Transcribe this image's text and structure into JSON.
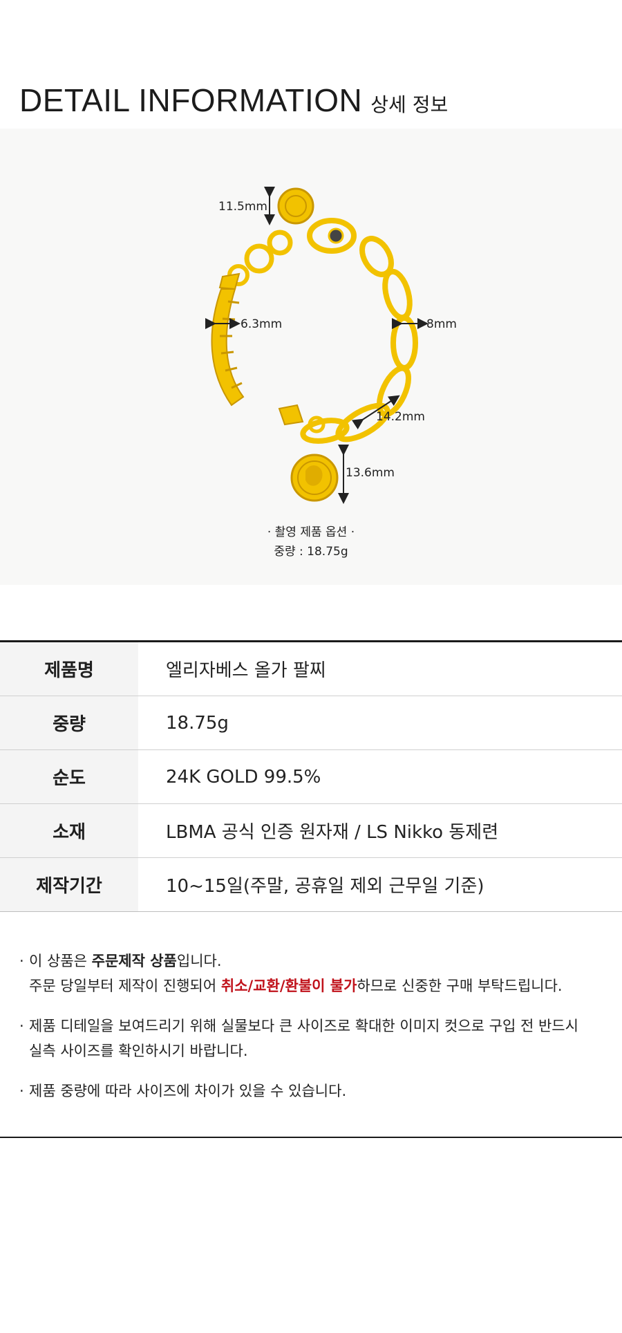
{
  "header": {
    "title_en": "DETAIL INFORMATION",
    "title_ko": "상세 정보"
  },
  "photo": {
    "dimensions": {
      "d1": "11.5mm",
      "d2": "6.3mm",
      "d3": "8mm",
      "d4": "14.2mm",
      "d5": "13.6mm"
    },
    "caption_line1": "· 촬영 제품 옵션 ·",
    "caption_line2": "중량 : 18.75g",
    "colors": {
      "gold": "#f2c200",
      "gold_dark": "#c99700",
      "background": "#f8f8f7"
    }
  },
  "spec": {
    "rows": [
      {
        "key": "제품명",
        "value": "엘리자베스 올가 팔찌"
      },
      {
        "key": "중량",
        "value": "18.75g"
      },
      {
        "key": "순도",
        "value": "24K GOLD 99.5%"
      },
      {
        "key": "소재",
        "value": "LBMA 공식 인증 원자재 / LS Nikko 동제련"
      },
      {
        "key": "제작기간",
        "value": "10~15일(주말, 공휴일 제외 근무일 기준)"
      }
    ]
  },
  "notes": {
    "n1_a": "이 상품은 ",
    "n1_b": "주문제작 상품",
    "n1_c": "입니다.",
    "n1_d": "주문 당일부터 제작이 진행되어 ",
    "n1_e": "취소/교환/환불이 불가",
    "n1_f": "하므로 신중한 구매 부탁드립니다.",
    "n2_a": "제품 디테일을 보여드리기 위해 실물보다 큰 사이즈로 확대한 이미지 컷으로 구입 전 반드시",
    "n2_b": "실측 사이즈를 확인하시기 바랍니다.",
    "n3": " 제품 중량에 따라 사이즈에 차이가 있을 수 있습니다.",
    "bullet": "·"
  }
}
